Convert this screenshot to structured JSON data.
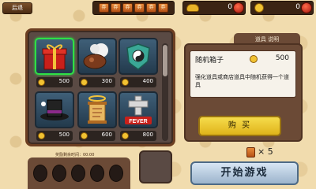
{
  "topbar": {
    "back_label": "后退",
    "ticket_glyph": "券",
    "ingot_value": "0",
    "coin_value": "0"
  },
  "items": [
    {
      "name": "gift-box",
      "price": "500",
      "selected": true
    },
    {
      "name": "bomb-cloud",
      "price": "300",
      "selected": false
    },
    {
      "name": "yin-yang-shield",
      "price": "400",
      "selected": false
    },
    {
      "name": "magic-hat",
      "price": "500",
      "selected": false
    },
    {
      "name": "scroll-halo",
      "price": "600",
      "selected": false
    },
    {
      "name": "fever-cross",
      "price": "800",
      "selected": false
    }
  ],
  "fever_label": "FEVER",
  "detail": {
    "tab_label": "道具 说明",
    "item_name": "随机箱子",
    "item_price": "500",
    "item_desc": "强化道具或商店道具中随机获得一个道具",
    "buy_label": "购 买"
  },
  "ticket_count": "× 5",
  "start_label": "开始游戏",
  "slots": {
    "title": "奖励剩余时间：00:00"
  }
}
